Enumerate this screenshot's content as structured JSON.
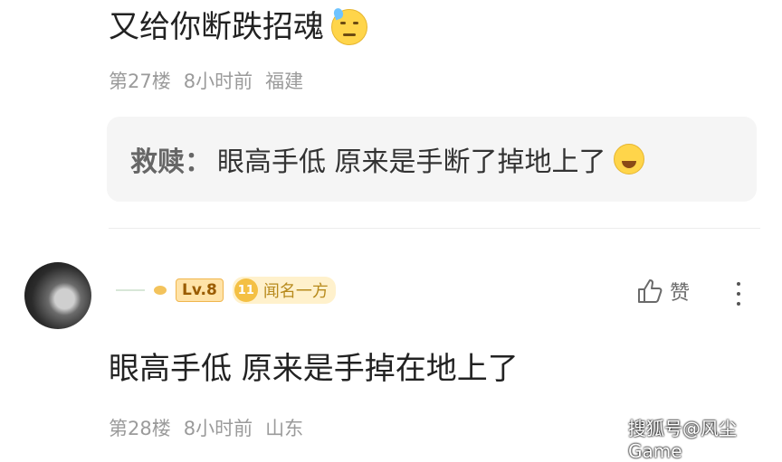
{
  "top_comment": {
    "text": "又给你断跌招魂",
    "emoji": "sweat-smile-emoji"
  },
  "top_meta": {
    "floor": "第27楼",
    "time": "8小时前",
    "location": "福建"
  },
  "reply": {
    "author": "救赎：",
    "text": "眼高手低 原来是手断了掉地上了",
    "emoji": "crying-emoji"
  },
  "user": {
    "level": "Lv.8",
    "fan_level": "11",
    "fan_title": "闻名一方"
  },
  "actions": {
    "like_label": "赞"
  },
  "comment2": {
    "text": "眼高手低 原来是手掉在地上了"
  },
  "meta2": {
    "floor": "第28楼",
    "time": "8小时前",
    "location": "山东"
  },
  "watermark": "搜狐号@风尘Game"
}
